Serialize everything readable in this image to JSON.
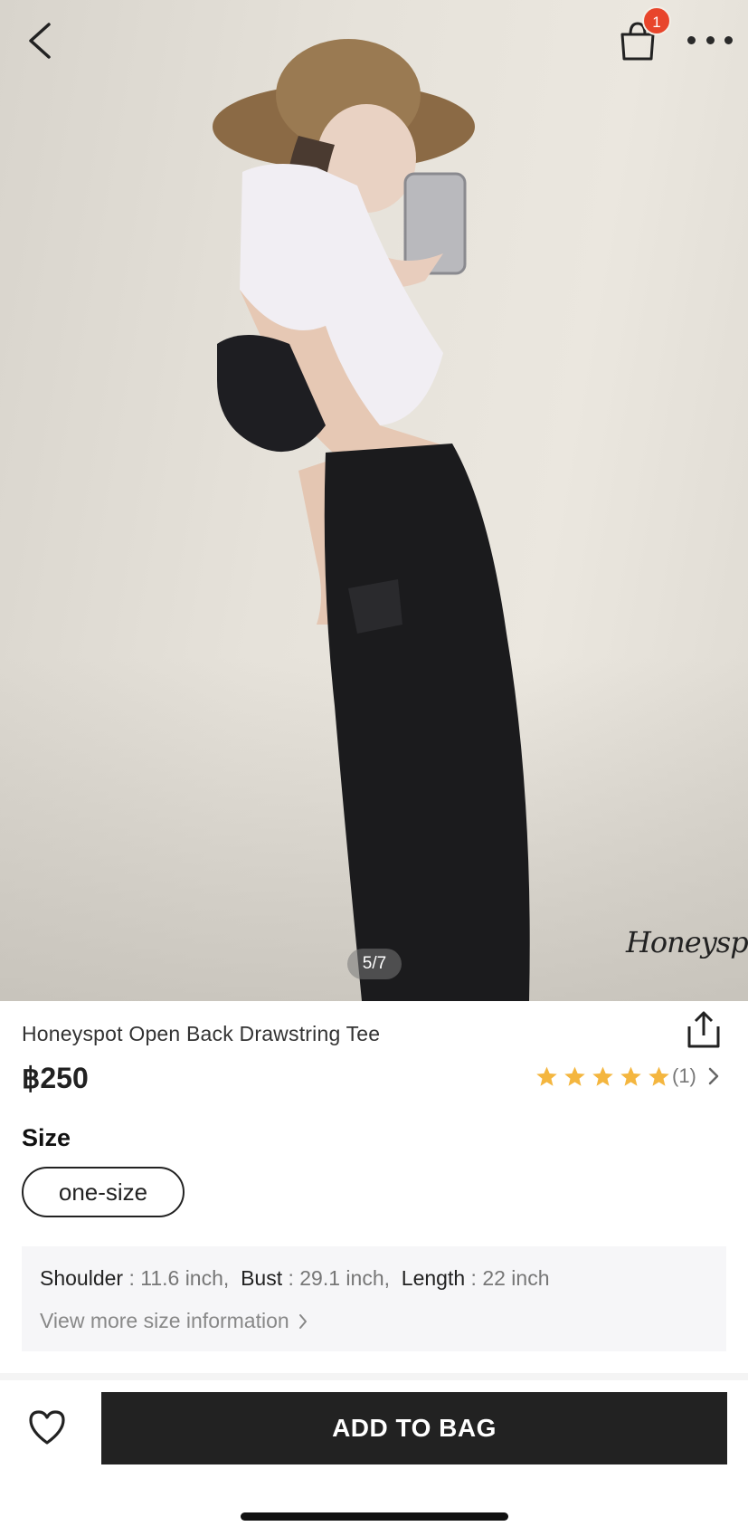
{
  "header": {
    "back_icon": "chevron-left-icon",
    "cart_icon": "shopping-bag-icon",
    "cart_count": "1",
    "more_icon": "more-horizontal-icon"
  },
  "gallery": {
    "counter": "5/7",
    "watermark": "Honeyspot"
  },
  "product": {
    "title": "Honeyspot Open Back Drawstring Tee",
    "price": "฿250",
    "rating_stars": 5,
    "rating_count": "(1)",
    "share_icon": "share-icon"
  },
  "size": {
    "label": "Size",
    "selected": "one-size",
    "measurements": [
      {
        "name": "Shoulder",
        "value": "11.6 inch,"
      },
      {
        "name": "Bust",
        "value": "29.1 inch,"
      },
      {
        "name": "Length",
        "value": "22 inch"
      }
    ],
    "more_link": "View more size information"
  },
  "actions": {
    "wishlist_icon": "heart-icon",
    "add_to_bag": "ADD TO BAG"
  },
  "colors": {
    "star": "#f4b63f",
    "badge": "#e8452b",
    "button": "#222222"
  }
}
